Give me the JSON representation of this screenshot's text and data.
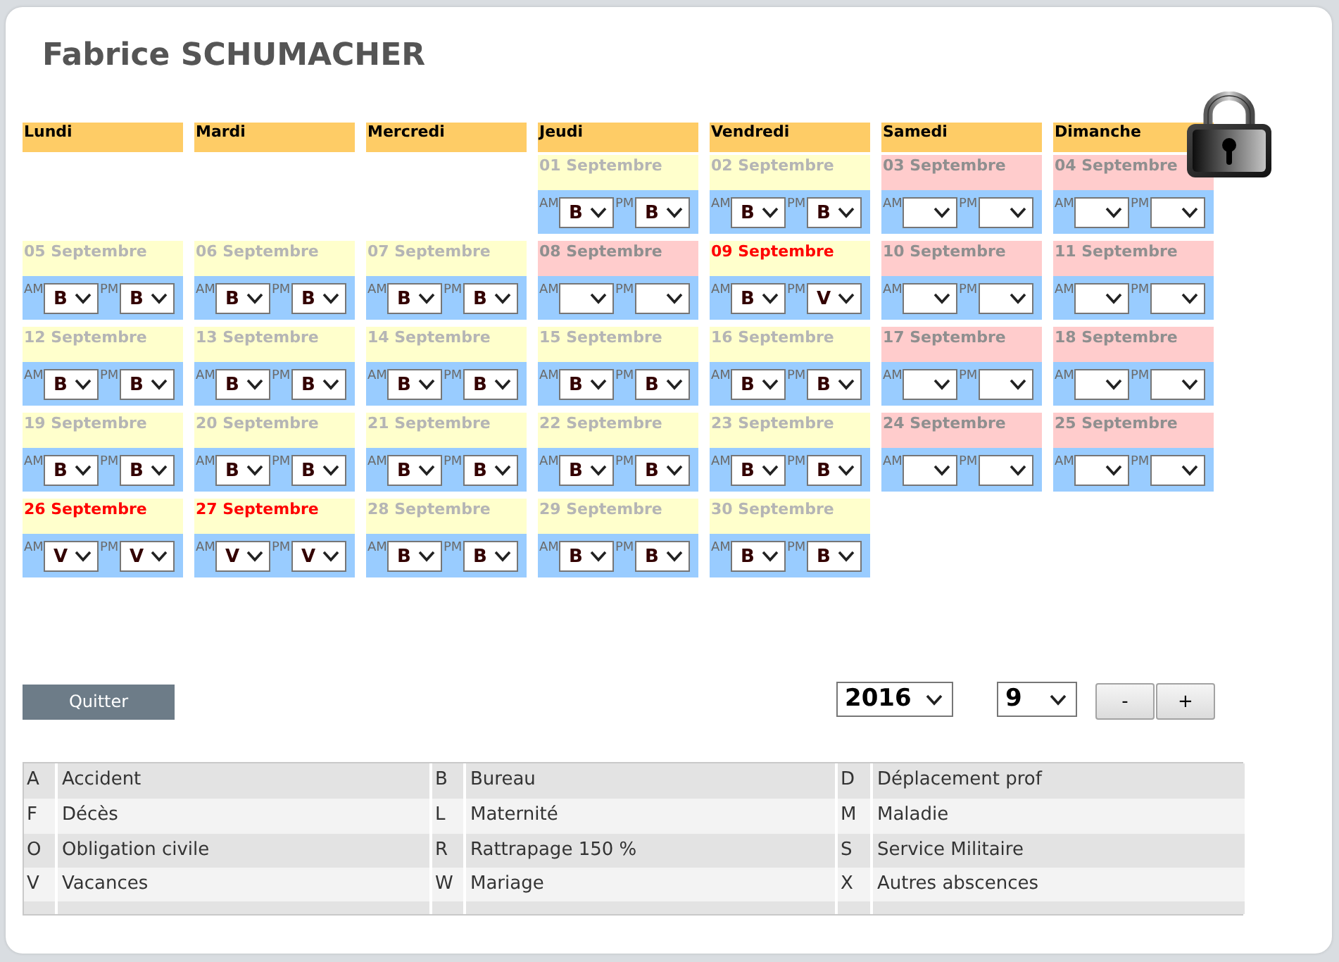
{
  "title": "Fabrice SCHUMACHER",
  "calendar": {
    "weekdays": [
      "Lundi",
      "Mardi",
      "Mercredi",
      "Jeudi",
      "Vendredi",
      "Samedi",
      "Dimanche"
    ],
    "weeks": [
      {
        "days": [
          {
            "kind": "empty"
          },
          {
            "kind": "empty"
          },
          {
            "kind": "empty"
          },
          {
            "kind": "day",
            "date": "01 Septembre",
            "holiday": false,
            "highlighted": false,
            "am": {
              "label": "AM",
              "value": "B"
            },
            "pm": {
              "label": "PM",
              "value": "B"
            }
          },
          {
            "kind": "day",
            "date": "02 Septembre",
            "holiday": false,
            "highlighted": false,
            "am": {
              "label": "AM",
              "value": "B"
            },
            "pm": {
              "label": "PM",
              "value": "B"
            }
          },
          {
            "kind": "day",
            "date": "03 Septembre",
            "holiday": true,
            "highlighted": false,
            "am": {
              "label": "AM"
            },
            "pm": {
              "label": "PM"
            }
          },
          {
            "kind": "day",
            "date": "04 Septembre",
            "holiday": true,
            "highlighted": false,
            "am": {
              "label": "AM"
            },
            "pm": {
              "label": "PM"
            }
          }
        ]
      },
      {
        "days": [
          {
            "kind": "day",
            "date": "05 Septembre",
            "holiday": false,
            "highlighted": false,
            "am": {
              "label": "AM",
              "value": "B"
            },
            "pm": {
              "label": "PM",
              "value": "B"
            }
          },
          {
            "kind": "day",
            "date": "06 Septembre",
            "holiday": false,
            "highlighted": false,
            "am": {
              "label": "AM",
              "value": "B"
            },
            "pm": {
              "label": "PM",
              "value": "B"
            }
          },
          {
            "kind": "day",
            "date": "07 Septembre",
            "holiday": false,
            "highlighted": false,
            "am": {
              "label": "AM",
              "value": "B"
            },
            "pm": {
              "label": "PM",
              "value": "B"
            }
          },
          {
            "kind": "day",
            "date": "08 Septembre",
            "holiday": true,
            "highlighted": false,
            "am": {
              "label": "AM"
            },
            "pm": {
              "label": "PM"
            }
          },
          {
            "kind": "day",
            "date": "09 Septembre",
            "holiday": false,
            "highlighted": true,
            "am": {
              "label": "AM",
              "value": "B"
            },
            "pm": {
              "label": "PM",
              "value": "V"
            }
          },
          {
            "kind": "day",
            "date": "10 Septembre",
            "holiday": true,
            "highlighted": false,
            "am": {
              "label": "AM"
            },
            "pm": {
              "label": "PM"
            }
          },
          {
            "kind": "day",
            "date": "11 Septembre",
            "holiday": true,
            "highlighted": false,
            "am": {
              "label": "AM"
            },
            "pm": {
              "label": "PM"
            }
          }
        ]
      },
      {
        "days": [
          {
            "kind": "day",
            "date": "12 Septembre",
            "holiday": false,
            "highlighted": false,
            "am": {
              "label": "AM",
              "value": "B"
            },
            "pm": {
              "label": "PM",
              "value": "B"
            }
          },
          {
            "kind": "day",
            "date": "13 Septembre",
            "holiday": false,
            "highlighted": false,
            "am": {
              "label": "AM",
              "value": "B"
            },
            "pm": {
              "label": "PM",
              "value": "B"
            }
          },
          {
            "kind": "day",
            "date": "14 Septembre",
            "holiday": false,
            "highlighted": false,
            "am": {
              "label": "AM",
              "value": "B"
            },
            "pm": {
              "label": "PM",
              "value": "B"
            }
          },
          {
            "kind": "day",
            "date": "15 Septembre",
            "holiday": false,
            "highlighted": false,
            "am": {
              "label": "AM",
              "value": "B"
            },
            "pm": {
              "label": "PM",
              "value": "B"
            }
          },
          {
            "kind": "day",
            "date": "16 Septembre",
            "holiday": false,
            "highlighted": false,
            "am": {
              "label": "AM",
              "value": "B"
            },
            "pm": {
              "label": "PM",
              "value": "B"
            }
          },
          {
            "kind": "day",
            "date": "17 Septembre",
            "holiday": true,
            "highlighted": false,
            "am": {
              "label": "AM"
            },
            "pm": {
              "label": "PM"
            }
          },
          {
            "kind": "day",
            "date": "18 Septembre",
            "holiday": true,
            "highlighted": false,
            "am": {
              "label": "AM"
            },
            "pm": {
              "label": "PM"
            }
          }
        ]
      },
      {
        "days": [
          {
            "kind": "day",
            "date": "19 Septembre",
            "holiday": false,
            "highlighted": false,
            "am": {
              "label": "AM",
              "value": "B"
            },
            "pm": {
              "label": "PM",
              "value": "B"
            }
          },
          {
            "kind": "day",
            "date": "20 Septembre",
            "holiday": false,
            "highlighted": false,
            "am": {
              "label": "AM",
              "value": "B"
            },
            "pm": {
              "label": "PM",
              "value": "B"
            }
          },
          {
            "kind": "day",
            "date": "21 Septembre",
            "holiday": false,
            "highlighted": false,
            "am": {
              "label": "AM",
              "value": "B"
            },
            "pm": {
              "label": "PM",
              "value": "B"
            }
          },
          {
            "kind": "day",
            "date": "22 Septembre",
            "holiday": false,
            "highlighted": false,
            "am": {
              "label": "AM",
              "value": "B"
            },
            "pm": {
              "label": "PM",
              "value": "B"
            }
          },
          {
            "kind": "day",
            "date": "23 Septembre",
            "holiday": false,
            "highlighted": false,
            "am": {
              "label": "AM",
              "value": "B"
            },
            "pm": {
              "label": "PM",
              "value": "B"
            }
          },
          {
            "kind": "day",
            "date": "24 Septembre",
            "holiday": true,
            "highlighted": false,
            "am": {
              "label": "AM"
            },
            "pm": {
              "label": "PM"
            }
          },
          {
            "kind": "day",
            "date": "25 Septembre",
            "holiday": true,
            "highlighted": false,
            "am": {
              "label": "AM"
            },
            "pm": {
              "label": "PM"
            }
          }
        ]
      },
      {
        "days": [
          {
            "kind": "day",
            "date": "26 Septembre",
            "holiday": false,
            "highlighted": true,
            "am": {
              "label": "AM",
              "value": "V"
            },
            "pm": {
              "label": "PM",
              "value": "V"
            }
          },
          {
            "kind": "day",
            "date": "27 Septembre",
            "holiday": false,
            "highlighted": true,
            "am": {
              "label": "AM",
              "value": "V"
            },
            "pm": {
              "label": "PM",
              "value": "V"
            }
          },
          {
            "kind": "day",
            "date": "28 Septembre",
            "holiday": false,
            "highlighted": false,
            "am": {
              "label": "AM",
              "value": "B"
            },
            "pm": {
              "label": "PM",
              "value": "B"
            }
          },
          {
            "kind": "day",
            "date": "29 Septembre",
            "holiday": false,
            "highlighted": false,
            "am": {
              "label": "AM",
              "value": "B"
            },
            "pm": {
              "label": "PM",
              "value": "B"
            }
          },
          {
            "kind": "day",
            "date": "30 Septembre",
            "holiday": false,
            "highlighted": false,
            "am": {
              "label": "AM",
              "value": "B"
            },
            "pm": {
              "label": "PM",
              "value": "B"
            }
          }
        ]
      }
    ]
  },
  "footer": {
    "quit_button": "Quitter",
    "year_select": {
      "value": "2016"
    },
    "month_select": {
      "value": "9"
    },
    "step_buttons": [
      "-",
      "+"
    ]
  },
  "legend": {
    "rows": [
      [
        {
          "code": "A",
          "label": "Accident"
        },
        {
          "code": "B",
          "label": "Bureau"
        },
        {
          "code": "D",
          "label": "Déplacement prof"
        }
      ],
      [
        {
          "code": "F",
          "label": "Décès"
        },
        {
          "code": "L",
          "label": "Maternité"
        },
        {
          "code": "M",
          "label": "Maladie"
        }
      ],
      [
        {
          "code": "O",
          "label": "Obligation civile"
        },
        {
          "code": "R",
          "label": "Rattrapage 150 %"
        },
        {
          "code": "S",
          "label": "Service Militaire"
        }
      ],
      [
        {
          "code": "V",
          "label": "Vacances"
        },
        {
          "code": "W",
          "label": "Mariage"
        },
        {
          "code": "X",
          "label": "Autres abscences"
        }
      ]
    ]
  }
}
